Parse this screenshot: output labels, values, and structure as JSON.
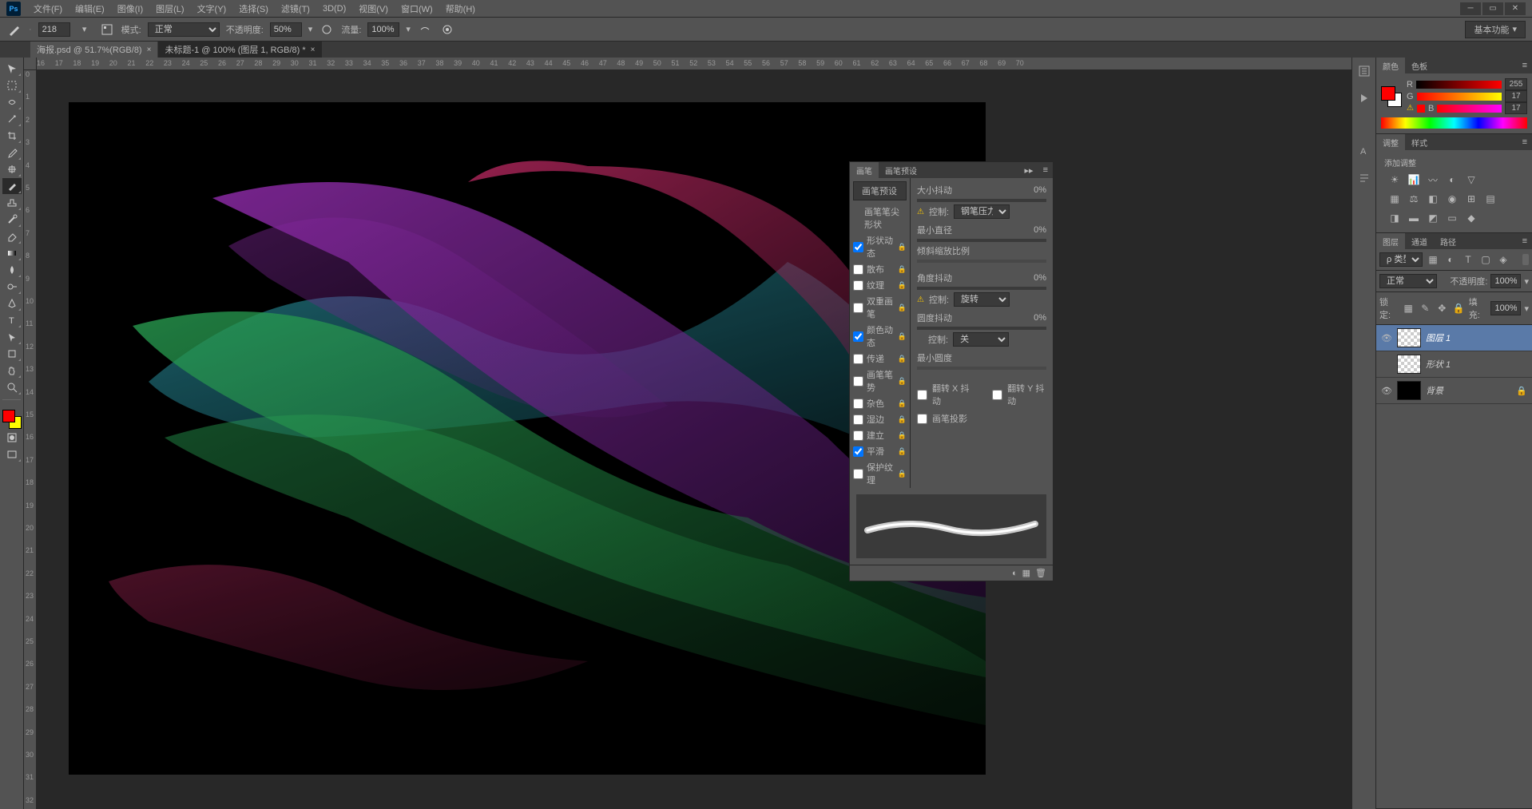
{
  "app": {
    "logo": "Ps"
  },
  "menu": [
    "文件(F)",
    "编辑(E)",
    "图像(I)",
    "图层(L)",
    "文字(Y)",
    "选择(S)",
    "滤镜(T)",
    "3D(D)",
    "视图(V)",
    "窗口(W)",
    "帮助(H)"
  ],
  "options": {
    "size": "218",
    "mode_label": "模式:",
    "mode": "正常",
    "opacity_label": "不透明度:",
    "opacity": "50%",
    "flow_label": "流量:",
    "flow": "100%"
  },
  "workspace": "基本功能",
  "tabs": [
    {
      "label": "海报.psd @ 51.7%(RGB/8)",
      "active": false
    },
    {
      "label": "未标题-1 @ 100% (图层 1, RGB/8) *",
      "active": true
    }
  ],
  "ruler_h": [
    "16",
    "17",
    "18",
    "19",
    "20",
    "21",
    "22",
    "23",
    "24",
    "25",
    "26",
    "27",
    "28",
    "29",
    "30",
    "31",
    "32",
    "33",
    "34",
    "35",
    "36",
    "37",
    "38",
    "39",
    "40",
    "41",
    "42",
    "43",
    "44",
    "45",
    "46",
    "47",
    "48",
    "49",
    "50",
    "51",
    "52",
    "53",
    "54",
    "55",
    "56",
    "57",
    "58",
    "59",
    "60",
    "61",
    "62",
    "63",
    "64",
    "65",
    "66",
    "67",
    "68",
    "69",
    "70"
  ],
  "ruler_v": [
    "0",
    "1",
    "2",
    "3",
    "4",
    "5",
    "6",
    "7",
    "8",
    "9",
    "10",
    "11",
    "12",
    "13",
    "14",
    "15",
    "16",
    "17",
    "18",
    "19",
    "20",
    "21",
    "22",
    "23",
    "24",
    "25",
    "26",
    "27",
    "28",
    "29",
    "30",
    "31",
    "32"
  ],
  "colorPanel": {
    "tab1": "颜色",
    "tab2": "色板",
    "r_label": "R",
    "r_val": "255",
    "g_label": "G",
    "g_val": "17",
    "b_label": "B",
    "b_val": "17"
  },
  "adjustPanel": {
    "tab1": "调整",
    "tab2": "样式",
    "title": "添加调整"
  },
  "layersPanel": {
    "tab1": "图层",
    "tab2": "通道",
    "tab3": "路径",
    "kind": "类型",
    "blend": "正常",
    "opacity_label": "不透明度:",
    "opacity": "100%",
    "lock_label": "锁定:",
    "fill_label": "填充:",
    "fill": "100%",
    "layers": [
      {
        "name": "图层 1",
        "visible": true,
        "selected": true,
        "thumb": "checker"
      },
      {
        "name": "形状 1",
        "visible": false,
        "selected": false,
        "thumb": "checker"
      },
      {
        "name": "背景",
        "visible": true,
        "selected": false,
        "thumb": "black",
        "locked": true
      }
    ]
  },
  "brushPanel": {
    "tab1": "画笔",
    "tab2": "画笔预设",
    "preset_btn": "画笔预设",
    "tip_shape": "画笔笔尖形状",
    "opts": [
      {
        "label": "形状动态",
        "checked": true,
        "locked": true
      },
      {
        "label": "散布",
        "checked": false,
        "locked": true
      },
      {
        "label": "纹理",
        "checked": false,
        "locked": true
      },
      {
        "label": "双重画笔",
        "checked": false,
        "locked": true
      },
      {
        "label": "颜色动态",
        "checked": true,
        "locked": false
      },
      {
        "label": "传递",
        "checked": false,
        "locked": true
      },
      {
        "label": "画笔笔势",
        "checked": false,
        "locked": true
      },
      {
        "label": "杂色",
        "checked": false,
        "locked": true
      },
      {
        "label": "湿边",
        "checked": false,
        "locked": true
      },
      {
        "label": "建立",
        "checked": false,
        "locked": true
      },
      {
        "label": "平滑",
        "checked": true,
        "locked": true
      },
      {
        "label": "保护纹理",
        "checked": false,
        "locked": true
      }
    ],
    "size_jitter": "大小抖动",
    "size_jitter_val": "0%",
    "control": "控制:",
    "control_val": "钢笔压力",
    "min_diameter": "最小直径",
    "min_diameter_val": "0%",
    "tilt_scale": "倾斜缩放比例",
    "angle_jitter": "角度抖动",
    "angle_jitter_val": "0%",
    "control2_val": "旋转",
    "round_jitter": "圆度抖动",
    "round_jitter_val": "0%",
    "control3_val": "关",
    "min_round": "最小圆度",
    "flip_x": "翻转 X 抖动",
    "flip_y": "翻转 Y 抖动",
    "brush_proj": "画笔投影"
  }
}
